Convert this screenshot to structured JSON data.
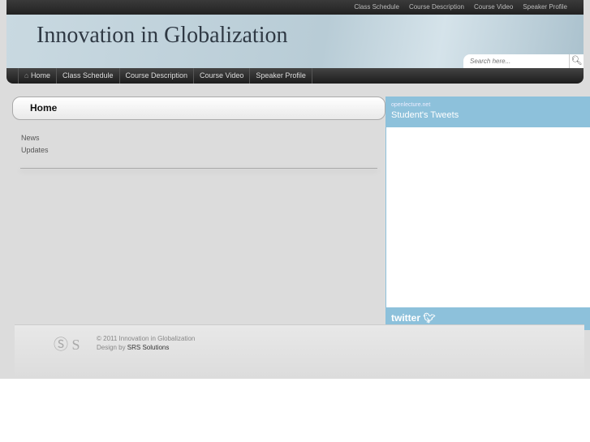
{
  "top_nav": [
    "Class Schedule",
    "Course Description",
    "Course Video",
    "Speaker Profile"
  ],
  "site_title": "Innovation in Globalization",
  "search": {
    "placeholder": "Search here..."
  },
  "main_nav": [
    "Home",
    "Class Schedule",
    "Course Description",
    "Course Video",
    "Speaker Profile"
  ],
  "page_heading": "Home",
  "links": [
    "News",
    "Updates"
  ],
  "tweets": {
    "source": "openlecture.net",
    "title": "Student's Tweets",
    "brand": "twitter"
  },
  "footer": {
    "copyright": "© 2011 Innovation in Globalization",
    "design_prefix": "Design by ",
    "designer": "SRS Solutions"
  }
}
